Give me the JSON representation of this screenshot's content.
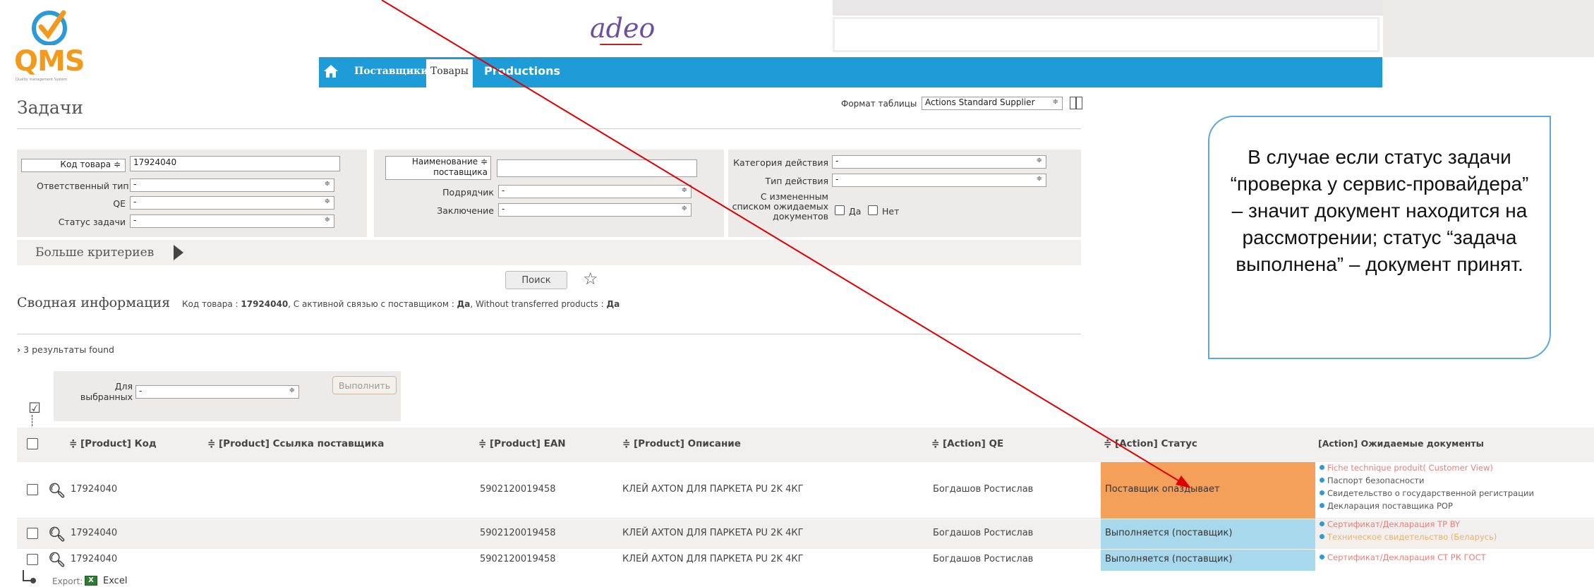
{
  "logo": {
    "name": "QMS",
    "subtitle": "Quality management System"
  },
  "brand": "adeo",
  "nav": {
    "suppliers": "Поставщики",
    "products": "Товары",
    "productions": "Productions"
  },
  "page_title": "Задачи",
  "table_format": {
    "label": "Формат таблицы",
    "value": "Actions Standard Supplier"
  },
  "filters": {
    "product_code_label": "Код товара ≑",
    "product_code_value": "17924040",
    "responsible_label": "Ответственный тип",
    "responsible_value": "-",
    "qe_label": "QE",
    "qe_value": "-",
    "task_status_label": "Статус задачи",
    "task_status_value": "-",
    "supplier_name_label1": "Наименование ≑",
    "supplier_name_label2": "поставщика",
    "subcontractor_label": "Подрядчик",
    "subcontractor_value": "-",
    "conclusion_label": "Заключение",
    "conclusion_value": "-",
    "action_category_label": "Категория действия",
    "action_category_value": "-",
    "action_type_label": "Тип действия",
    "action_type_value": "-",
    "changed_docs_label1": "С измененным",
    "changed_docs_label2": "списком ожидаемых",
    "changed_docs_label3": "документов",
    "yes": "Да",
    "no": "Нет"
  },
  "more_criteria": "Больше критериев",
  "search_button": "Поиск",
  "summary": {
    "title": "Сводная информация",
    "text_prefix": "Код товара : ",
    "code": "17924040",
    "text_mid": ", С активной связью с поставщиком : ",
    "active": "Да",
    "text_mid2": ", Without transferred products : ",
    "without": "Да"
  },
  "results_count": "3 результаты found",
  "bulk": {
    "label1": "Для",
    "label2": "выбранных",
    "value": "-",
    "execute": "Выполнить"
  },
  "columns": [
    "≑ [Product] Код",
    "≑ [Product] Ссылка поставщика",
    "≑ [Product] EAN",
    "≑ [Product] Описание",
    "≑ [Action] QE",
    "≑ [Action] Статус",
    "[Action] Ожидаемые документы"
  ],
  "rows": [
    {
      "code": "17924040",
      "ean": "5902120019458",
      "desc": "КЛЕЙ AXTON ДЛЯ ПАРКЕТА PU 2K 4КГ",
      "qe": "Богдашов Ростислав",
      "status": "Поставщик опаздывает",
      "docs": [
        "Fiche technique produit( Customer View)",
        "Паспорт безопасности",
        "Свидетельство о государственной регистрации",
        "Декларация поставщика POP"
      ]
    },
    {
      "code": "17924040",
      "ean": "5902120019458",
      "desc": "КЛЕЙ AXTON ДЛЯ ПАРКЕТА PU 2K 4КГ",
      "qe": "Богдашов Ростислав",
      "status": "Выполняется (поставщик)",
      "docs": [
        "Сертификат/Декларация ТР BY",
        "Техническое свидетельство (Беларусь)"
      ]
    },
    {
      "code": "17924040",
      "ean": "5902120019458",
      "desc": "КЛЕЙ AXTON ДЛЯ ПАРКЕТА PU 2K 4КГ",
      "qe": "Богдашов Ростислав",
      "status": "Выполняется (поставщик)",
      "docs": [
        "Сертификат/Декларация СТ РК ГОСТ"
      ]
    }
  ],
  "export": {
    "label": "Export:",
    "excel": "Excel"
  },
  "callout": "В случае если статус задачи “проверка у сервис-провайдера” – значит документ находится на рассмотрении; статус “задача выполнена” – документ принят.",
  "colors": {
    "nav": "#1e9cd7",
    "late": "#f5a05a",
    "progress": "#a8d8ec",
    "callout_border": "#5aa9e0",
    "arrow": "#e00000"
  }
}
